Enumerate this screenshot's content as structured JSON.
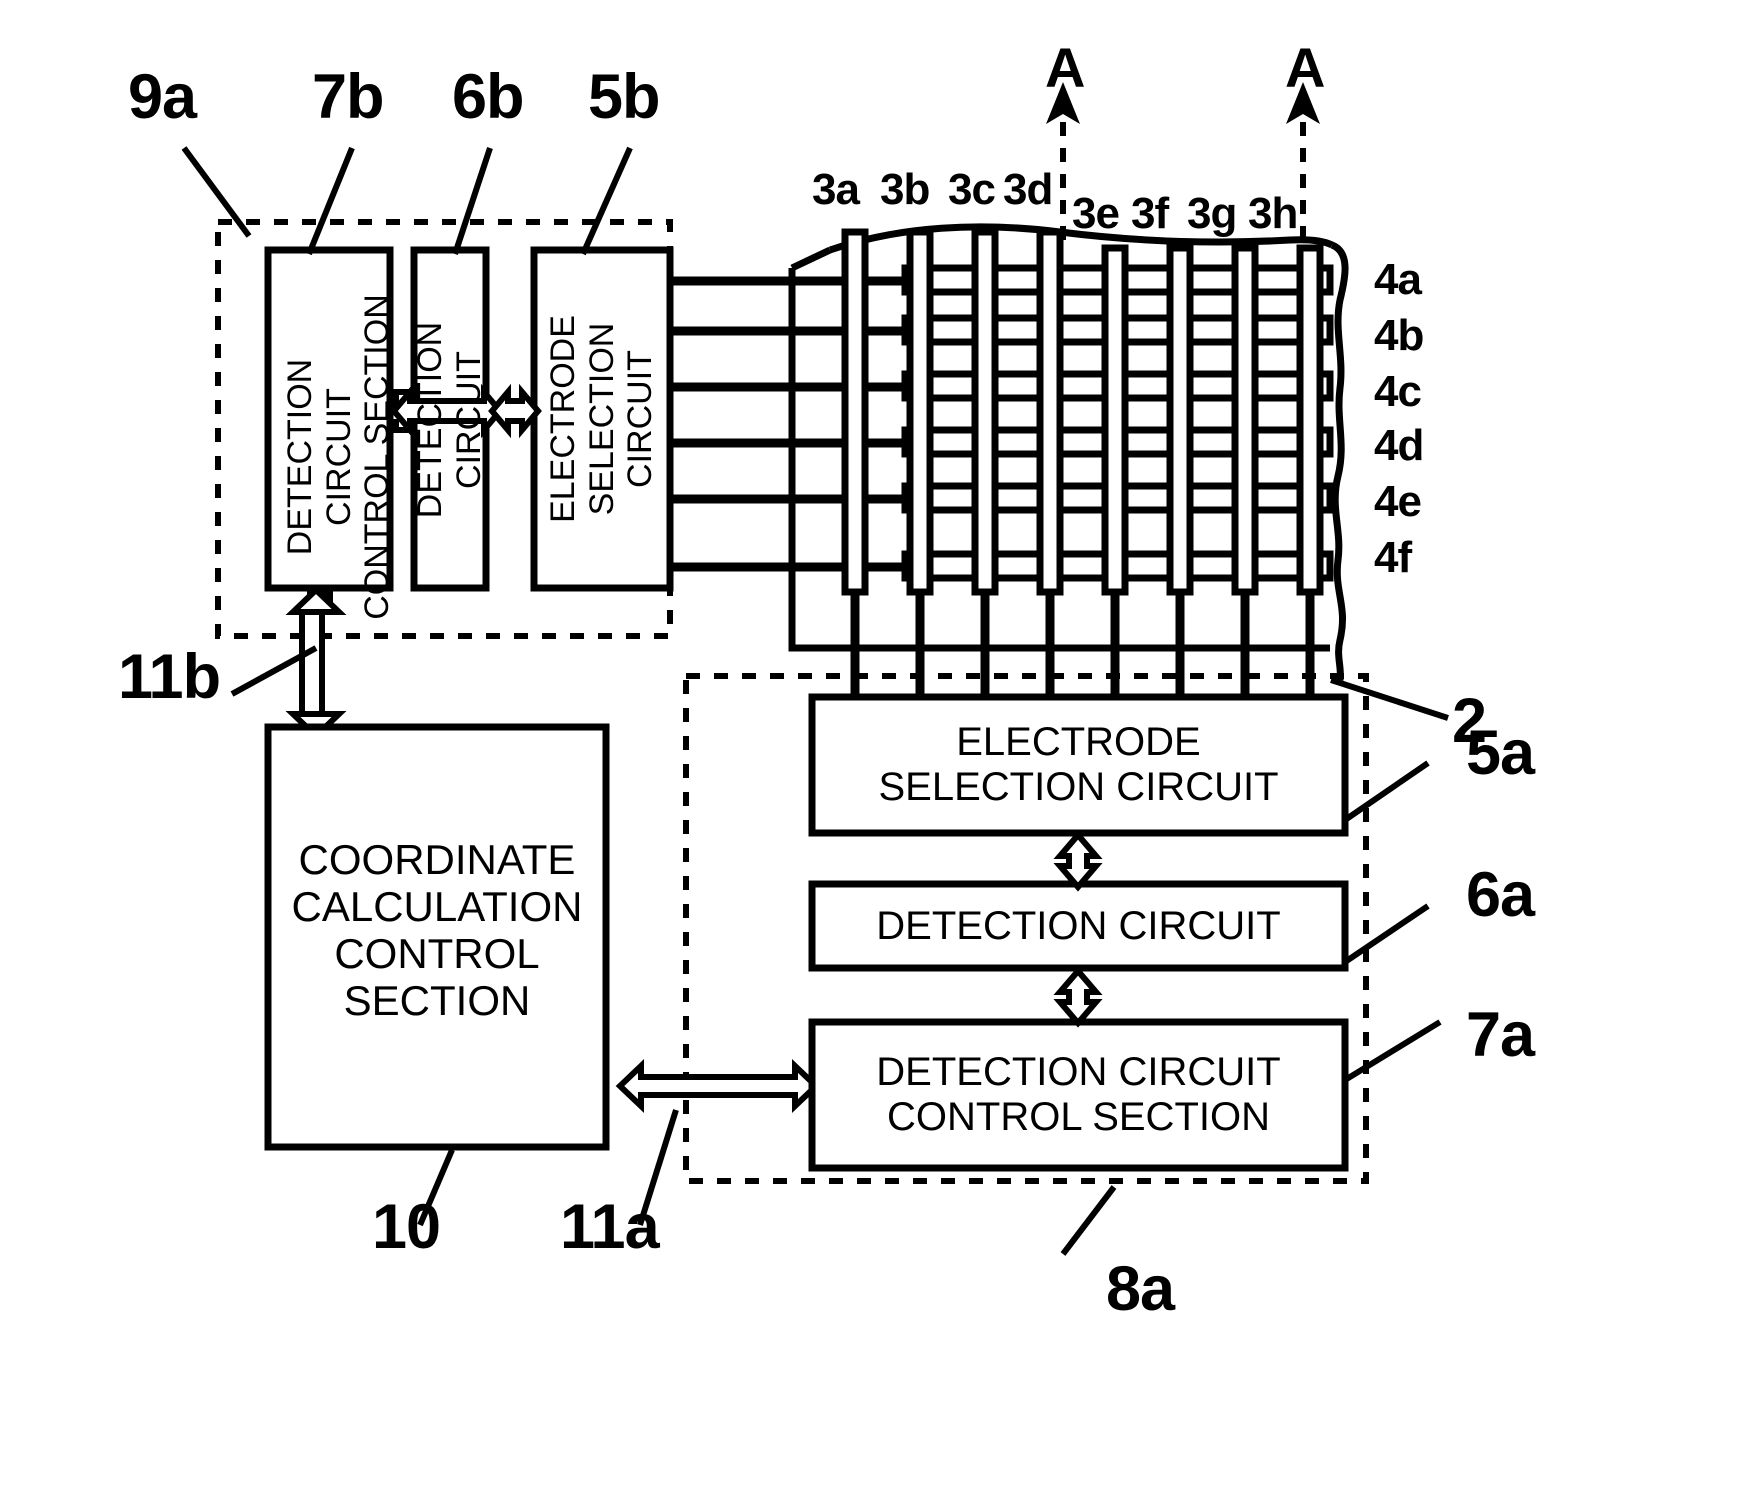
{
  "figure": {
    "type": "patent-block-diagram",
    "background": "#ffffff",
    "ink": "#000000"
  },
  "reference_numerals": {
    "top_left": [
      "9a",
      "7b",
      "6b",
      "5b"
    ],
    "left_lower": [
      "11b",
      "10",
      "11a"
    ],
    "panel": [
      "2"
    ],
    "right": [
      "5a",
      "6a",
      "7a",
      "8a"
    ]
  },
  "labels": {
    "n9a": "9a",
    "n7b": "7b",
    "n6b": "6b",
    "n5b": "5b",
    "n11b": "11b",
    "n10": "10",
    "n11a": "11a",
    "n2": "2",
    "n5a": "5a",
    "n6a": "6a",
    "n7a": "7a",
    "n8a": "8a",
    "section_A_left": "A",
    "section_A_right": "A"
  },
  "column_electrodes": {
    "group_left": [
      "3a",
      "3b",
      "3c",
      "3d"
    ],
    "group_right": [
      "3e",
      "3f",
      "3g",
      "3h"
    ]
  },
  "row_electrodes": [
    "4a",
    "4b",
    "4c",
    "4d",
    "4e",
    "4f"
  ],
  "blocks": {
    "vertical": [
      {
        "id": "7b",
        "text": "DETECTION CIRCUIT\nCONTROL SECTION"
      },
      {
        "id": "6b",
        "text": "DETECTION CIRCUIT"
      },
      {
        "id": "5b",
        "text": "ELECTRODE\nSELECTION CIRCUIT"
      }
    ],
    "horizontal": [
      {
        "id": "5a",
        "text": "ELECTRODE\nSELECTION CIRCUIT"
      },
      {
        "id": "6a",
        "text": "DETECTION CIRCUIT"
      },
      {
        "id": "7a",
        "text": "DETECTION CIRCUIT\nCONTROL SECTION"
      },
      {
        "id": "10",
        "text": "COORDINATE\nCALCULATION\nCONTROL\nSECTION"
      }
    ]
  },
  "dashed_groups": [
    {
      "id": "9a",
      "name": "left-detection-group"
    },
    {
      "id": "8a",
      "name": "bottom-detection-group"
    }
  ],
  "connectors": {
    "bus_11b": "11b",
    "bus_11a": "11a",
    "double_arrows": [
      "7b-6b",
      "6b-5b",
      "5a-6a",
      "6a-7a",
      "10-7a",
      "9a-10"
    ]
  }
}
